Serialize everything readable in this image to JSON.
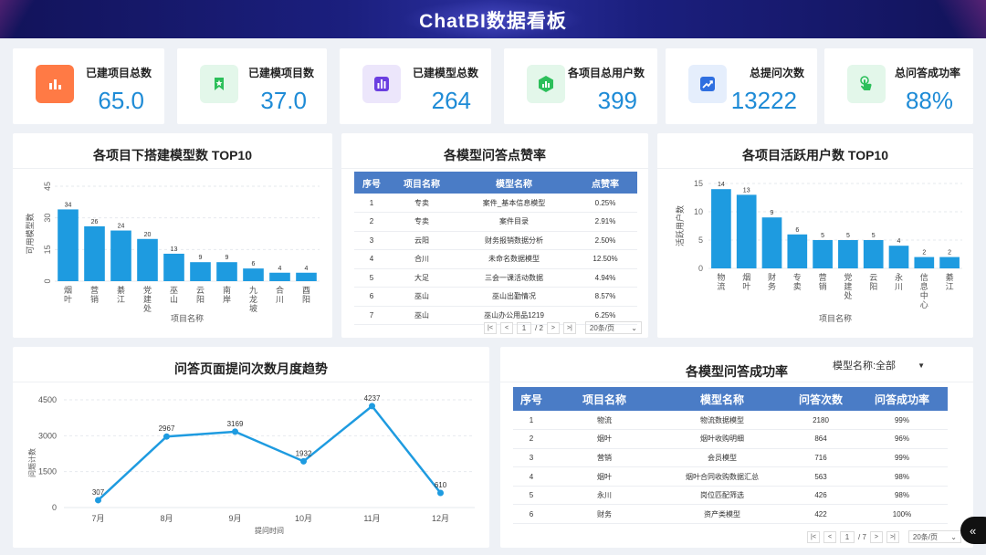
{
  "header": {
    "title": "ChatBI数据看板"
  },
  "kpis": [
    {
      "label": "已建项目总数",
      "value": "65.0",
      "icon": "bar-chart-icon",
      "bg": "#ff7a45",
      "fg": "#ffffff"
    },
    {
      "label": "已建模项目数",
      "value": "37.0",
      "icon": "bookmark-star-icon",
      "bg": "#e3f7ea",
      "fg": "#2cbf5a"
    },
    {
      "label": "已建模型总数",
      "value": "264",
      "icon": "bar-chart-icon",
      "bg": "#ece6fb",
      "fg": "#6b3fe0"
    },
    {
      "label": "各项目总用户数",
      "value": "399",
      "icon": "hexagon-chart-icon",
      "bg": "#e3f7ea",
      "fg": "#2cbf5a"
    },
    {
      "label": "总提问次数",
      "value": "13222",
      "icon": "trend-up-icon",
      "bg": "#e5eefc",
      "fg": "#2f6fe0"
    },
    {
      "label": "总问答成功率",
      "value": "88%",
      "icon": "pointer-hand-icon",
      "bg": "#e3f7ea",
      "fg": "#2cbf5a"
    }
  ],
  "panel_model_top10": {
    "title": "各项目下搭建模型数 TOP10"
  },
  "panel_like_rate": {
    "title": "各模型问答点赞率",
    "columns": [
      "序号",
      "项目名称",
      "模型名称",
      "点赞率"
    ],
    "rows": [
      [
        "1",
        "专卖",
        "案件_基本信息模型",
        "0.25%"
      ],
      [
        "2",
        "专卖",
        "案件目录",
        "2.91%"
      ],
      [
        "3",
        "云阳",
        "财务报销数据分析",
        "2.50%"
      ],
      [
        "4",
        "合川",
        "未命名数据模型",
        "12.50%"
      ],
      [
        "5",
        "大足",
        "三会一课活动数据",
        "4.94%"
      ],
      [
        "6",
        "巫山",
        "巫山出勤情况",
        "8.57%"
      ],
      [
        "7",
        "巫山",
        "巫山办公用品1219",
        "6.25%"
      ]
    ],
    "pager": {
      "current": "1",
      "total": "/ 2",
      "size": "20条/页"
    }
  },
  "panel_active_top10": {
    "title": "各项目活跃用户数 TOP10"
  },
  "panel_trend": {
    "title": "问答页面提问次数月度趋势"
  },
  "panel_success": {
    "title": "各模型问答成功率",
    "filter": {
      "label": "模型名称:全部"
    },
    "columns": [
      "序号",
      "项目名称",
      "模型名称",
      "问答次数",
      "问答成功率"
    ],
    "rows": [
      [
        "1",
        "物流",
        "物流数据模型",
        "2180",
        "99%"
      ],
      [
        "2",
        "烟叶",
        "烟叶收购明细",
        "864",
        "96%"
      ],
      [
        "3",
        "营销",
        "会员模型",
        "716",
        "99%"
      ],
      [
        "4",
        "烟叶",
        "烟叶合同收购数据汇总",
        "563",
        "98%"
      ],
      [
        "5",
        "永川",
        "岗位匹配筛选",
        "426",
        "98%"
      ],
      [
        "6",
        "财务",
        "资产类模型",
        "422",
        "100%"
      ]
    ],
    "pager": {
      "current": "1",
      "total": "/ 7",
      "size": "20条/页"
    }
  },
  "chart_data": [
    {
      "type": "bar",
      "title": "各项目下搭建模型数 TOP10",
      "xlabel": "项目名称",
      "ylabel": "可用模型数",
      "categories": [
        "烟叶",
        "营销",
        "綦江",
        "党建处",
        "巫山",
        "云阳",
        "南岸",
        "九龙坡",
        "合川",
        "酉阳"
      ],
      "values": [
        34,
        26,
        24,
        20,
        13,
        9,
        9,
        6,
        4,
        4
      ],
      "yticks": [
        0,
        15,
        30,
        45
      ],
      "ylim": [
        0,
        45
      ],
      "color": "#1e9be0"
    },
    {
      "type": "bar",
      "title": "各项目活跃用户数 TOP10",
      "xlabel": "项目名称",
      "ylabel": "活跃用户数",
      "categories": [
        "物流",
        "烟叶",
        "财务",
        "专卖",
        "营销",
        "党建处",
        "云阳",
        "永川",
        "信息中心",
        "綦江"
      ],
      "values": [
        14,
        13,
        9,
        6,
        5,
        5,
        5,
        4,
        2,
        2
      ],
      "yticks": [
        0,
        5,
        10,
        15
      ],
      "ylim": [
        0,
        15
      ],
      "color": "#1e9be0"
    },
    {
      "type": "line",
      "title": "问答页面提问次数月度趋势",
      "xlabel": "提问时间",
      "ylabel": "问题计数",
      "categories": [
        "7月",
        "8月",
        "9月",
        "10月",
        "11月",
        "12月"
      ],
      "values": [
        307,
        2967,
        3169,
        1932,
        4237,
        610
      ],
      "yticks": [
        0,
        1500,
        3000,
        4500
      ],
      "ylim": [
        0,
        4500
      ],
      "color": "#1e9be0"
    }
  ]
}
